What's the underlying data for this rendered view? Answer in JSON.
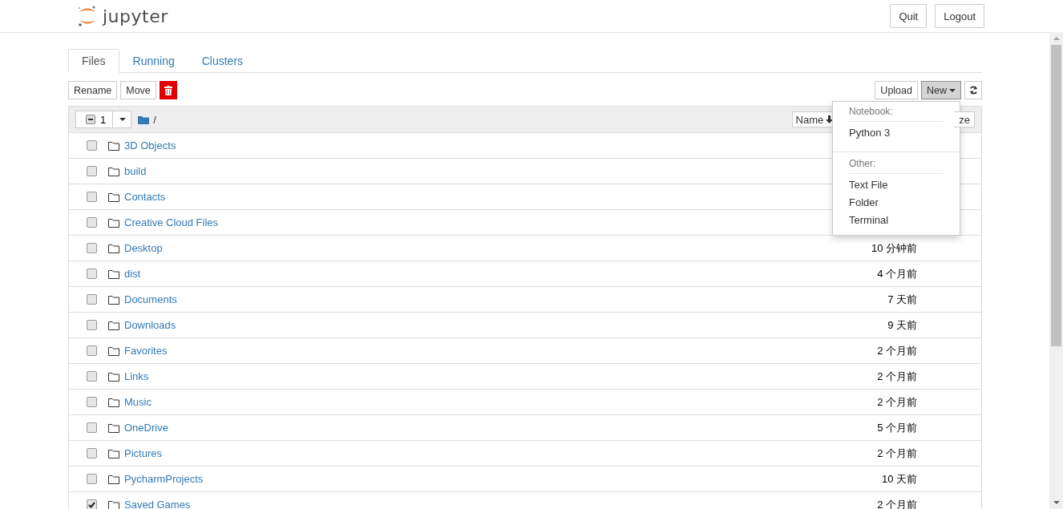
{
  "header": {
    "logo_text": "jupyter",
    "buttons": [
      {
        "label": "Quit"
      },
      {
        "label": "Logout"
      }
    ]
  },
  "tabs": [
    {
      "label": "Files",
      "selected": true
    },
    {
      "label": "Running",
      "selected": false
    },
    {
      "label": "Clusters",
      "selected": false
    }
  ],
  "toolbar": {
    "left": [
      {
        "kind": "text",
        "label": "Rename"
      },
      {
        "kind": "text",
        "label": "Move"
      },
      {
        "kind": "delete"
      }
    ],
    "right": [
      {
        "kind": "text",
        "label": "Upload",
        "selected": false
      },
      {
        "kind": "dropdown",
        "label": "New",
        "selected": true
      },
      {
        "kind": "refresh",
        "selected": false
      }
    ]
  },
  "list_header": {
    "select_all_partial": true,
    "selected_count": "1",
    "path": "/",
    "sort_button": "Name",
    "size_button_visible": "ze"
  },
  "new_menu": {
    "sections": [
      {
        "heading": "Notebook:",
        "items": [
          "Python 3"
        ]
      },
      {
        "heading": "Other:",
        "items": [
          "Text File",
          "Folder",
          "Terminal"
        ]
      }
    ]
  },
  "rows": [
    {
      "name": "3D Objects",
      "checked": false
    },
    {
      "name": "build",
      "checked": false
    },
    {
      "name": "Contacts",
      "checked": false
    },
    {
      "name": "Creative Cloud Files",
      "checked": false
    },
    {
      "name": "Desktop",
      "modified": "10 分钟前",
      "checked": false
    },
    {
      "name": "dist",
      "modified": "4 个月前",
      "checked": false
    },
    {
      "name": "Documents",
      "modified": "7 天前",
      "checked": false
    },
    {
      "name": "Downloads",
      "modified": "9 天前",
      "checked": false
    },
    {
      "name": "Favorites",
      "modified": "2 个月前",
      "checked": false
    },
    {
      "name": "Links",
      "modified": "2 个月前",
      "checked": false
    },
    {
      "name": "Music",
      "modified": "2 个月前",
      "checked": false
    },
    {
      "name": "OneDrive",
      "modified": "5 个月前",
      "checked": false
    },
    {
      "name": "Pictures",
      "modified": "2 个月前",
      "checked": false
    },
    {
      "name": "PycharmProjects",
      "modified": "10 天前",
      "checked": false
    },
    {
      "name": "Saved Games",
      "modified": "2 个月前",
      "checked": true
    }
  ]
}
